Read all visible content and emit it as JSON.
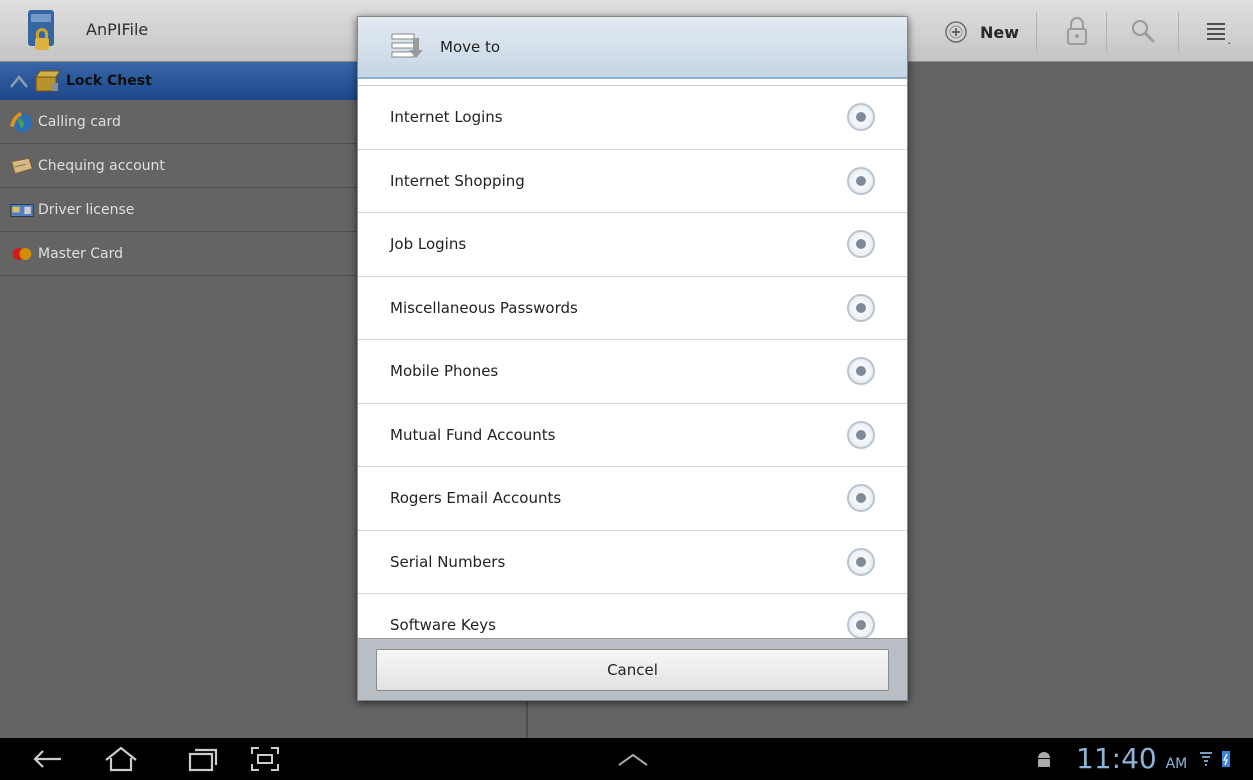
{
  "app": {
    "title": "AnPIFile",
    "icon": "bag-lock-icon"
  },
  "actionbar": {
    "new_label": "New",
    "icons": [
      "plus-circle-icon",
      "lock-icon",
      "search-icon",
      "menu-icon"
    ]
  },
  "list": {
    "header": {
      "label": "Lock Chest",
      "icon": "chest-icon"
    },
    "items": [
      {
        "label": "Calling card",
        "icon": "globe-phone-icon"
      },
      {
        "label": "Chequing account",
        "icon": "cheque-icon"
      },
      {
        "label": "Driver license",
        "icon": "id-card-icon"
      },
      {
        "label": "Master Card",
        "icon": "mastercard-icon"
      }
    ]
  },
  "dialog": {
    "title": "Move to",
    "icon": "move-to-icon",
    "options": [
      {
        "label": "Internet Logins"
      },
      {
        "label": "Internet Shopping"
      },
      {
        "label": "Job Logins"
      },
      {
        "label": "Miscellaneous Passwords"
      },
      {
        "label": "Mobile Phones"
      },
      {
        "label": "Mutual Fund Accounts"
      },
      {
        "label": "Rogers Email Accounts"
      },
      {
        "label": "Serial Numbers"
      },
      {
        "label": "Software Keys"
      }
    ],
    "cancel_label": "Cancel"
  },
  "system": {
    "time": "11:40",
    "ampm": "AM",
    "clock_color": "#8cb4d8"
  }
}
